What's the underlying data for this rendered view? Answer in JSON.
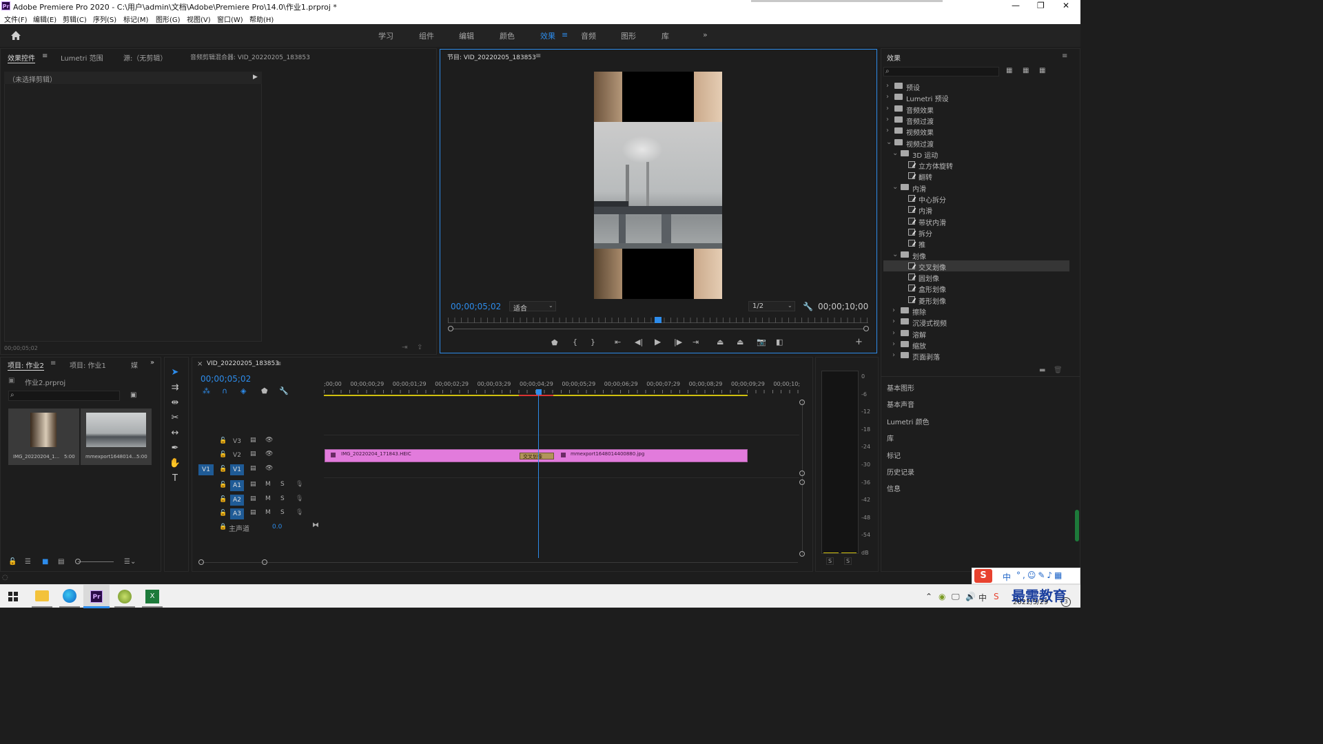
{
  "titlebar": {
    "title": "Adobe Premiere Pro 2020 - C:\\用户\\admin\\文档\\Adobe\\Premiere Pro\\14.0\\作业1.prproj *",
    "app_icon": "Pr"
  },
  "menu": [
    "文件(F)",
    "编辑(E)",
    "剪辑(C)",
    "序列(S)",
    "标记(M)",
    "图形(G)",
    "视图(V)",
    "窗口(W)",
    "帮助(H)"
  ],
  "workspaces": [
    "学习",
    "组件",
    "编辑",
    "颜色",
    "效果",
    "音频",
    "图形",
    "库"
  ],
  "active_workspace": "效果",
  "source_panel": {
    "tabs": [
      "效果控件",
      "Lumetri 范围",
      "源:（无剪辑）",
      "音频剪辑混合器: VID_20220205_183853"
    ],
    "no_clip": "（未选择剪辑）",
    "timecode": "00;00;05;02"
  },
  "program_monitor": {
    "title": "节目: VID_20220205_183853",
    "timecode": "00;00;05;02",
    "fit": "适合",
    "resolution": "1/2",
    "duration": "00;00;10;00",
    "playhead_fraction": 0.5
  },
  "project_panel": {
    "tabs": [
      "项目: 作业2",
      "项目: 作业1",
      "媒"
    ],
    "file": "作业2.prproj",
    "items": [
      {
        "name": "IMG_20220204_1...",
        "duration": "5:00"
      },
      {
        "name": "mmexport1648014...",
        "duration": "5:00"
      }
    ]
  },
  "timeline": {
    "tab": "VID_20220205_183853",
    "timecode": "00;00;05;02",
    "ruler": [
      ";00;00",
      "00;00;00;29",
      "00;00;01;29",
      "00;00;02;29",
      "00;00;03;29",
      "00;00;04;29",
      "00;00;05;29",
      "00;00;06;29",
      "00;00;07;29",
      "00;00;08;29",
      "00;00;09;29",
      "00;00;10;"
    ],
    "tracks": [
      {
        "name": "V3",
        "type": "video",
        "source": ""
      },
      {
        "name": "V2",
        "type": "video",
        "source": ""
      },
      {
        "name": "V1",
        "type": "video",
        "source": "V1"
      },
      {
        "name": "A1",
        "type": "audio",
        "source": ""
      },
      {
        "name": "A2",
        "type": "audio",
        "source": ""
      },
      {
        "name": "A3",
        "type": "audio",
        "source": ""
      }
    ],
    "mute": "M",
    "solo": "S",
    "master": {
      "label": "主声道",
      "value": "0.0"
    },
    "clips": [
      {
        "name": "IMG_20220204_171843.HEIC"
      },
      {
        "name": "mmexport1648014400880.jpg"
      }
    ],
    "transition": "交叉划像"
  },
  "effects_panel": {
    "title": "效果",
    "tree": [
      {
        "label": "预设",
        "kind": "folder",
        "level": 0,
        "open": false
      },
      {
        "label": "Lumetri 预设",
        "kind": "folder",
        "level": 0,
        "open": false
      },
      {
        "label": "音频效果",
        "kind": "folder",
        "level": 0,
        "open": false
      },
      {
        "label": "音频过渡",
        "kind": "folder",
        "level": 0,
        "open": false
      },
      {
        "label": "视频效果",
        "kind": "folder",
        "level": 0,
        "open": false
      },
      {
        "label": "视频过渡",
        "kind": "folder",
        "level": 0,
        "open": true
      },
      {
        "label": "3D 运动",
        "kind": "folder",
        "level": 1,
        "open": true
      },
      {
        "label": "立方体旋转",
        "kind": "item",
        "level": 2
      },
      {
        "label": "翻转",
        "kind": "item",
        "level": 2
      },
      {
        "label": "内滑",
        "kind": "folder",
        "level": 1,
        "open": true
      },
      {
        "label": "中心拆分",
        "kind": "item",
        "level": 2
      },
      {
        "label": "内滑",
        "kind": "item",
        "level": 2
      },
      {
        "label": "带状内滑",
        "kind": "item",
        "level": 2
      },
      {
        "label": "拆分",
        "kind": "item",
        "level": 2
      },
      {
        "label": "推",
        "kind": "item",
        "level": 2
      },
      {
        "label": "划像",
        "kind": "folder",
        "level": 1,
        "open": true
      },
      {
        "label": "交叉划像",
        "kind": "item",
        "level": 2,
        "selected": true
      },
      {
        "label": "圆划像",
        "kind": "item",
        "level": 2
      },
      {
        "label": "盒形划像",
        "kind": "item",
        "level": 2
      },
      {
        "label": "菱形划像",
        "kind": "item",
        "level": 2
      },
      {
        "label": "擦除",
        "kind": "folder",
        "level": 1,
        "open": false
      },
      {
        "label": "沉浸式视频",
        "kind": "folder",
        "level": 1,
        "open": false
      },
      {
        "label": "溶解",
        "kind": "folder",
        "level": 1,
        "open": false
      },
      {
        "label": "缩放",
        "kind": "folder",
        "level": 1,
        "open": false
      },
      {
        "label": "页面剥落",
        "kind": "folder",
        "level": 1,
        "open": false
      }
    ],
    "other_panels": [
      "基本图形",
      "基本声音",
      "Lumetri 颜色",
      "库",
      "标记",
      "历史记录",
      "信息"
    ]
  },
  "audio_meter": {
    "scale": [
      "0",
      "-6",
      "-12",
      "-18",
      "-24",
      "-30",
      "-36",
      "-42",
      "-48",
      "-54",
      "dB"
    ],
    "solo": "S"
  },
  "taskbar": {
    "watermark": "最需教育",
    "date": "2022/3/29",
    "ime": "中"
  },
  "colors": {
    "accent": "#2d8ceb",
    "clip": "#e27bdc",
    "selected_tab": "#2d8ceb",
    "timecode": "#2d8ceb"
  }
}
